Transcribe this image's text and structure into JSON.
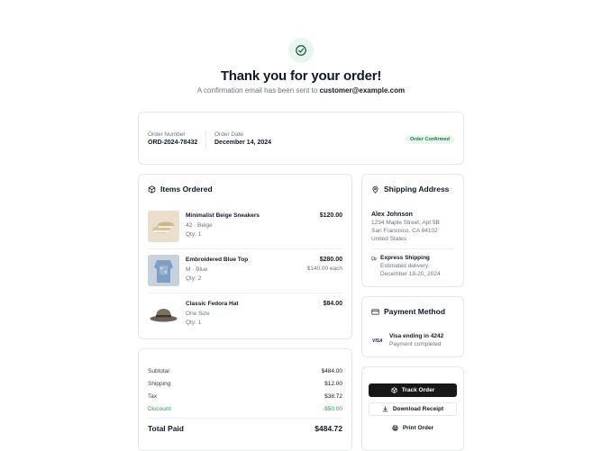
{
  "header": {
    "title": "Thank you for your order!",
    "subtitle_prefix": "A confirmation email has been sent to ",
    "email": "customer@example.com"
  },
  "order_info": {
    "number_label": "Order Number",
    "number": "ORD-2024-78432",
    "date_label": "Order Date",
    "date": "December 14, 2024",
    "status": "Order Confirmed"
  },
  "items": {
    "title": "Items Ordered",
    "list": [
      {
        "name": "Minimalist Beige Sneakers",
        "variant": "42 · Beige",
        "qty": "Qty: 1",
        "price": "$120.00",
        "each": ""
      },
      {
        "name": "Embroidered Blue Top",
        "variant": "M · Blue",
        "qty": "Qty: 2",
        "price": "$280.00",
        "each": "$140.00 each"
      },
      {
        "name": "Classic Fedora Hat",
        "variant": "One Size",
        "qty": "Qty: 1",
        "price": "$84.00",
        "each": ""
      }
    ]
  },
  "summary": {
    "subtotal_label": "Subtotal",
    "subtotal": "$484.00",
    "shipping_label": "Shipping",
    "shipping": "$12.00",
    "tax_label": "Tax",
    "tax": "$38.72",
    "discount_label": "Discount",
    "discount": "-$50.00",
    "total_label": "Total Paid",
    "total": "$484.72"
  },
  "shipping_address": {
    "title": "Shipping Address",
    "name": "Alex Johnson",
    "line1": "1234 Maple Street, Apt 5B",
    "line2": "San Francisco, CA 94102",
    "country": "United States",
    "method": "Express Shipping",
    "estimate_label": "Estimated delivery:",
    "estimate": "December 18-20, 2024"
  },
  "payment": {
    "title": "Payment Method",
    "card_brand": "VISA",
    "card": "Visa ending in 4242",
    "status": "Payment completed"
  },
  "actions": {
    "track": "Track Order",
    "download": "Download Receipt",
    "print": "Print Order"
  },
  "colors": {
    "accent_green": "#16a34a",
    "dark_button": "#18181b",
    "visa_blue": "#1a1f71"
  }
}
